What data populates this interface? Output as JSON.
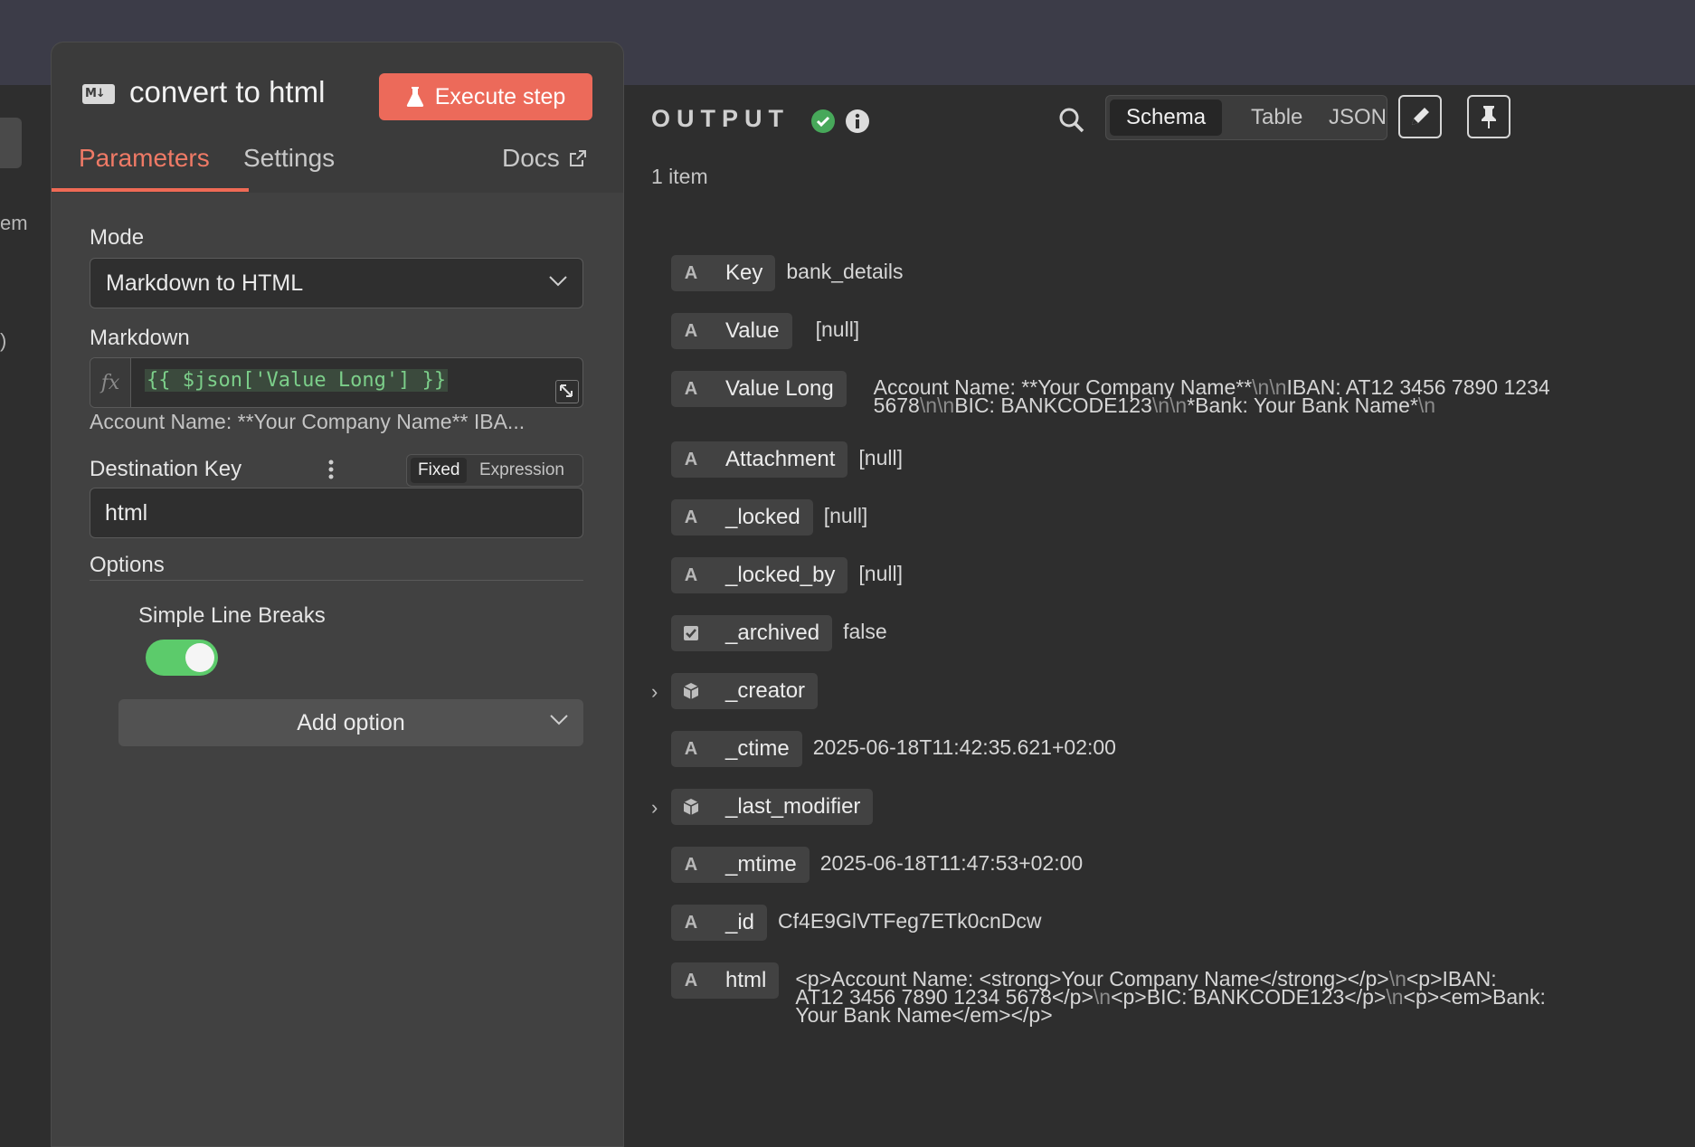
{
  "left_fragments": [
    "em",
    ")"
  ],
  "node": {
    "icon": "markdown-icon",
    "title": "convert to html",
    "execute_label": "Execute step",
    "tabs": [
      "Parameters",
      "Settings"
    ],
    "docs_label": "Docs",
    "mode_label": "Mode",
    "mode_value": "Markdown to HTML",
    "markdown_label": "Markdown",
    "markdown_fx": "fx",
    "markdown_expression": "{{ $json['Value Long'] }}",
    "markdown_preview": "Account Name: **Your Company Name** IBA...",
    "dest_key_label": "Destination Key",
    "dest_toggle_fixed": "Fixed",
    "dest_toggle_expression": "Expression",
    "dest_key_value": "html",
    "options_label": "Options",
    "simple_line_breaks_label": "Simple Line Breaks",
    "simple_line_breaks_on": true,
    "add_option_label": "Add option"
  },
  "output": {
    "title": "OUTPUT",
    "views": [
      "Schema",
      "Table",
      "JSON"
    ],
    "active_view": "Schema",
    "item_count": "1 item",
    "colors": {
      "accent": "#ec6a5a",
      "success": "#5ccb6b"
    },
    "fields": [
      {
        "type": "string",
        "key": "Key",
        "value": "bank_details"
      },
      {
        "type": "string",
        "key": "Value",
        "value": "[null]"
      },
      {
        "type": "string",
        "key": "Value Long",
        "value_line1": "Account Name: **Your Company Name**\\n\\nIBAN: AT12 3456 7890 1234",
        "value_line2": "5678\\n\\nBIC: BANKCODE123\\n\\n*Bank: Your Bank Name*\\n"
      },
      {
        "type": "string",
        "key": "Attachment",
        "value": "[null]"
      },
      {
        "type": "string",
        "key": "_locked",
        "value": "[null]"
      },
      {
        "type": "string",
        "key": "_locked_by",
        "value": "[null]"
      },
      {
        "type": "boolean",
        "key": "_archived",
        "value": "false"
      },
      {
        "type": "object",
        "key": "_creator"
      },
      {
        "type": "string",
        "key": "_ctime",
        "value": "2025-06-18T11:42:35.621+02:00"
      },
      {
        "type": "object",
        "key": "_last_modifier"
      },
      {
        "type": "string",
        "key": "_mtime",
        "value": "2025-06-18T11:47:53+02:00"
      },
      {
        "type": "string",
        "key": "_id",
        "value": "Cf4E9GlVTFeg7ETk0cnDcw"
      },
      {
        "type": "string",
        "key": "html",
        "value_line1": "<p>Account Name: <strong>Your Company Name</strong></p>\\n<p>IBAN:",
        "value_line2": "AT12 3456 7890 1234 5678</p>\\n<p>BIC: BANKCODE123</p>\\n<p><em>Bank:",
        "value_line3": "Your Bank Name</em></p>"
      }
    ]
  }
}
